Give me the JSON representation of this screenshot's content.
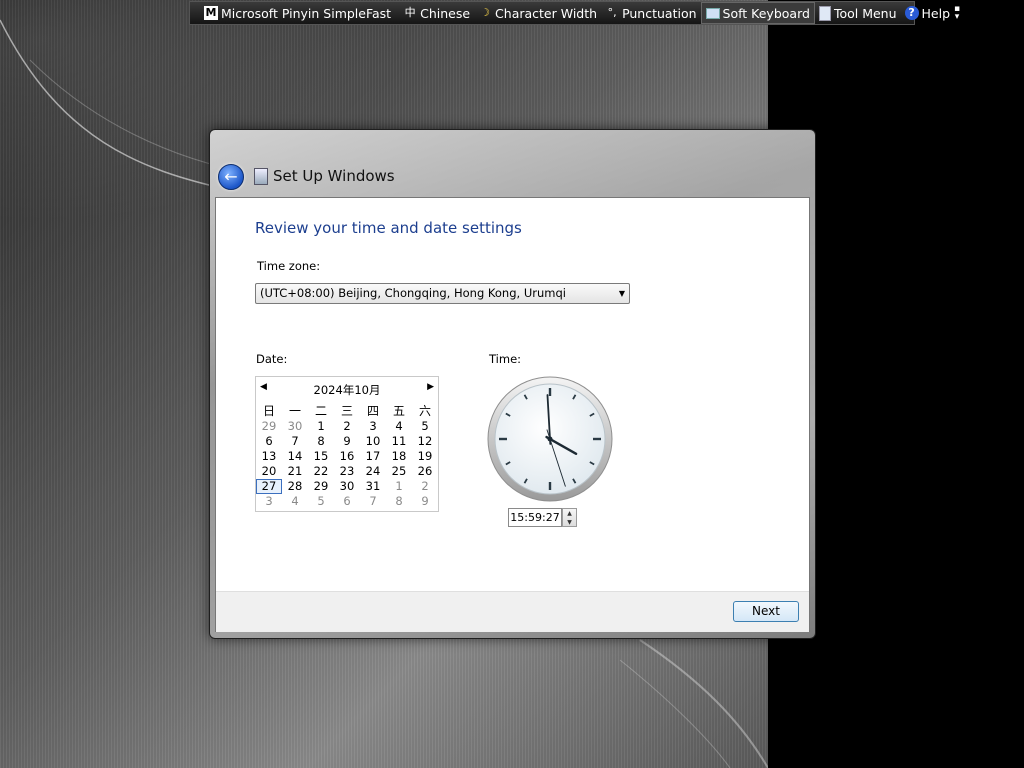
{
  "language_bar": {
    "items": [
      {
        "icon": "m-icon",
        "label": "Microsoft Pinyin SimpleFast"
      },
      {
        "icon": "zhong-icon",
        "icon_glyph": "中",
        "label": "Chinese"
      },
      {
        "icon": "moon-icon",
        "icon_glyph": "☽",
        "label": "Character Width"
      },
      {
        "icon": "punctuation-icon",
        "icon_glyph": "°,",
        "label": "Punctuation"
      },
      {
        "icon": "keyboard-icon",
        "label": "Soft Keyboard"
      },
      {
        "icon": "tool-menu-icon",
        "label": "Tool Menu"
      },
      {
        "icon": "help-icon",
        "icon_glyph": "?",
        "label": "Help"
      }
    ]
  },
  "window": {
    "title": "Set Up Windows",
    "heading": "Review your time and date settings",
    "timezone": {
      "label": "Time zone:",
      "value": "(UTC+08:00) Beijing, Chongqing, Hong Kong, Urumqi"
    },
    "date": {
      "label": "Date:",
      "calendar": {
        "title": "2024年10月",
        "weekdays": [
          "日",
          "一",
          "二",
          "三",
          "四",
          "五",
          "六"
        ],
        "weeks": [
          [
            "29",
            "30",
            "1",
            "2",
            "3",
            "4",
            "5"
          ],
          [
            "6",
            "7",
            "8",
            "9",
            "10",
            "11",
            "12"
          ],
          [
            "13",
            "14",
            "15",
            "16",
            "17",
            "18",
            "19"
          ],
          [
            "20",
            "21",
            "22",
            "23",
            "24",
            "25",
            "26"
          ],
          [
            "27",
            "28",
            "29",
            "30",
            "31",
            "1",
            "2"
          ],
          [
            "3",
            "4",
            "5",
            "6",
            "7",
            "8",
            "9"
          ]
        ],
        "selected_day": "27"
      }
    },
    "time": {
      "label": "Time:",
      "value": "15:59:27"
    },
    "next_button": "Next"
  }
}
